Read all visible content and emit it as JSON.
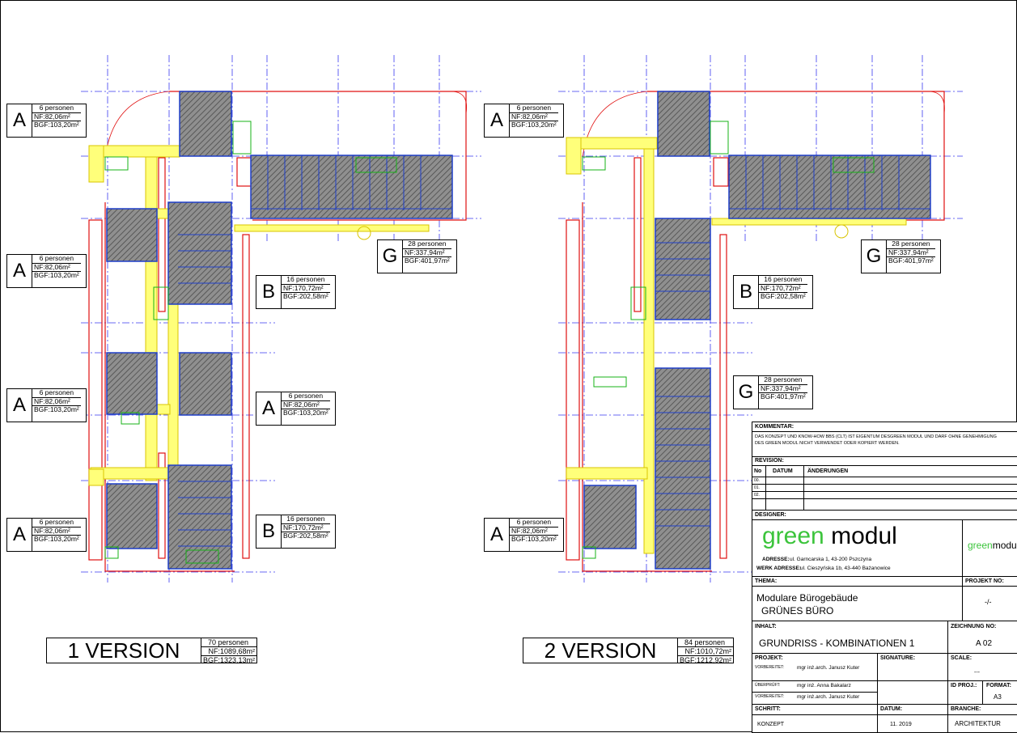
{
  "version1": {
    "title": "1 VERSION",
    "persons": "70 personen",
    "nf": "NF:1089,68m²",
    "bgf": "BGF:1323,13m²"
  },
  "version2": {
    "title": "2 VERSION",
    "persons": "84 personen",
    "nf": "NF:1010,72m²",
    "bgf": "BGF:1212,92m²"
  },
  "tags": {
    "v1_a1": {
      "letter": "A",
      "persons": "6 personen",
      "nf": "NF:82,06m²",
      "bgf": "BGF:103,20m²"
    },
    "v1_a2": {
      "letter": "A",
      "persons": "6 personen",
      "nf": "NF:82,06m²",
      "bgf": "BGF:103,20m²"
    },
    "v1_a3": {
      "letter": "A",
      "persons": "6 personen",
      "nf": "NF:82,06m²",
      "bgf": "BGF:103,20m²"
    },
    "v1_a4": {
      "letter": "A",
      "persons": "6 personen",
      "nf": "NF:82,06m²",
      "bgf": "BGF:103,20m²"
    },
    "v1_a5": {
      "letter": "A",
      "persons": "6 personen",
      "nf": "NF:82,06m²",
      "bgf": "BGF:103,20m²"
    },
    "v1_b1": {
      "letter": "B",
      "persons": "16 personen",
      "nf": "NF:170,72m²",
      "bgf": "BGF:202,58m²"
    },
    "v1_b2": {
      "letter": "B",
      "persons": "16 personen",
      "nf": "NF:170,72m²",
      "bgf": "BGF:202,58m²"
    },
    "v1_g1": {
      "letter": "G",
      "persons": "28 personen",
      "nf": "NF:337,94m²",
      "bgf": "BGF:401,97m²"
    },
    "v2_a1": {
      "letter": "A",
      "persons": "6 personen",
      "nf": "NF:82,06m²",
      "bgf": "BGF:103,20m²"
    },
    "v2_a2": {
      "letter": "A",
      "persons": "6 personen",
      "nf": "NF:82,06m²",
      "bgf": "BGF:103,20m²"
    },
    "v2_b1": {
      "letter": "B",
      "persons": "16 personen",
      "nf": "NF:170,72m²",
      "bgf": "BGF:202,58m²"
    },
    "v2_g1": {
      "letter": "G",
      "persons": "28 personen",
      "nf": "NF:337,94m²",
      "bgf": "BGF:401,97m²"
    },
    "v2_g2": {
      "letter": "G",
      "persons": "28 personen",
      "nf": "NF:337,94m²",
      "bgf": "BGF:401,97m²"
    }
  },
  "titleblock": {
    "kommentar_h": "KOMMENTAR:",
    "kommentar_1": "DAS KONZEPT UND KNOW-HOW BBS (CLT) IST EIGENTUM DESGREEN MODUL UND DARF OHNE GENEHMIGUNG",
    "kommentar_2": "DES GREEN MODUL NICHT VERWENDET ODER KOPIERT WERDEN.",
    "revision_h": "REVISION:",
    "no_h": "No",
    "datum_h": "DATUM",
    "aenderungen_h": "ÄNDERUNGEN",
    "rev_rows": [
      "00.",
      "01.",
      "02."
    ],
    "designer_h": "DESIGNER:",
    "logo_green": "green",
    "logo_modul": "modul",
    "adresse_label": "ADRESSE:",
    "adresse_value": "ul. Garncarska 1, 43-200 Pszczyna",
    "werk_label": "WERK ADRESSE:",
    "werk_value": "ul. Cieszyńska 1b,  43-440 Bażanowice",
    "thema_h": "THEMA:",
    "projekt_no_h": "PROJEKT NO:",
    "thema_1": "Modulare Bürogebäude",
    "thema_2": "GRÜNES BÜRO",
    "projekt_no_v": "-/-",
    "inhalt_h": "INHALT:",
    "zeichnung_h": "ZEICHNUNG NO:",
    "inhalt_v": "GRUNDRISS - KOMBINATIONEN 1",
    "zeichnung_v": "A 02",
    "projekt_h": "PROJEKT:",
    "signature_h": "SIGNATURE:",
    "scale_h": "SCALE:",
    "vorbereitet1": "VORBEREITET:",
    "person1": "mgr inż.arch. Janusz Kuter",
    "ueberprueft": "ÜBERPRÜFT:",
    "person2": "mgr inż. Anna Bakalarz",
    "vorbereitet2": "VORBEREITET:",
    "person3": "mgr inż.arch. Janusz Kuter",
    "scale_v": "---",
    "idproj_h": "ID PROJ.:",
    "format_h": "FORMAT:",
    "format_v": "A3",
    "schritt_h": "SCHRITT:",
    "datum2_h": "DATUM:",
    "branche_h": "BRANCHE:",
    "schritt_v": "KONZEPT",
    "datum_v": "11. 2019",
    "branche_v": "ARCHITEKTUR"
  }
}
